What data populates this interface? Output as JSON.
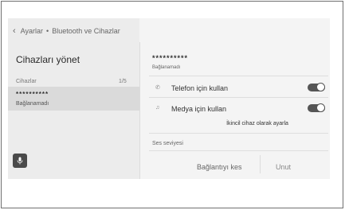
{
  "breadcrumb": {
    "back_icon": "chevron-left-icon",
    "level1": "Ayarlar",
    "separator": "•",
    "level2": "Bluetooth ve Cihazlar"
  },
  "left_panel": {
    "title": "Cihazları yönet",
    "list_label": "Cihazlar",
    "list_count": "1/5",
    "devices": [
      {
        "name": "**********",
        "status": "Bağlanamadı"
      }
    ],
    "mic_icon": "microphone-icon"
  },
  "detail": {
    "device_name": "**********",
    "device_status": "Bağlanamadı",
    "settings": [
      {
        "icon": "phone-icon",
        "label": "Telefon için kullan",
        "on": true
      },
      {
        "icon": "music-note-icon",
        "label": "Medya için kullan",
        "on": true
      }
    ],
    "secondary_label": "İkincil cihaz olarak ayarla",
    "volume_label": "Ses seviyesi",
    "disconnect_label": "Bağlantıyı kes",
    "forget_label": "Unut"
  },
  "colors": {
    "toggle_on": "#555555",
    "selected_row": "#dadada",
    "screen_bg": "#f4f4f4"
  }
}
